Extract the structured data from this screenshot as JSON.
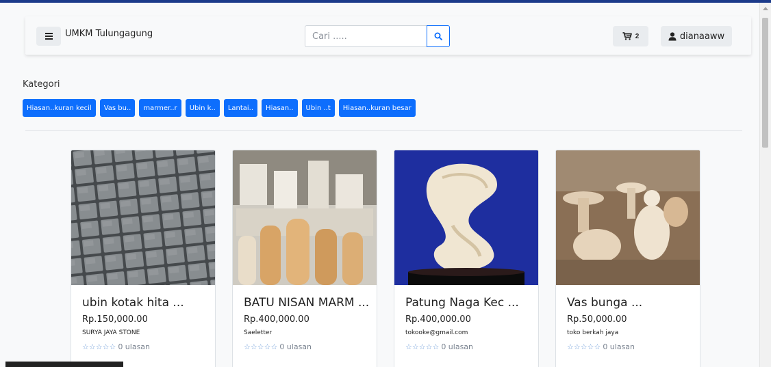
{
  "header": {
    "brand": "UMKM Tulungagung",
    "search_placeholder": "Cari .....",
    "cart_count": "2",
    "username": "dianaaww"
  },
  "category_section": {
    "title": "Kategori",
    "items": [
      "Hiasan..kuran kecil",
      "Vas bu..",
      "marmer..r",
      "Ubin k..",
      "Lantai..",
      "Hiasan..",
      "Ubin ..t",
      "Hiasan..kuran besar"
    ]
  },
  "products": [
    {
      "name": "ubin kotak hita ...",
      "price": "Rp.150,000.00",
      "shop": "SURYA JAYA STONE",
      "stars": "☆☆☆☆☆",
      "reviews": "0 ulasan"
    },
    {
      "name": "BATU NISAN MARM ...",
      "price": "Rp.400,000.00",
      "shop": "Saeletter",
      "stars": "☆☆☆☆☆",
      "reviews": "0 ulasan"
    },
    {
      "name": "Patung Naga Kec ...",
      "price": "Rp.400,000.00",
      "shop": "tokooke@gmail.com",
      "stars": "☆☆☆☆☆",
      "reviews": "0 ulasan"
    },
    {
      "name": "Vas bunga ...",
      "price": "Rp.50,000.00",
      "shop": "toko berkah jaya",
      "stars": "☆☆☆☆☆",
      "reviews": "0 ulasan"
    }
  ],
  "status_bar_text": "",
  "colors": {
    "primary": "#0d6efd",
    "top_accent": "#1b3a8a",
    "background": "#f8f9fa"
  }
}
